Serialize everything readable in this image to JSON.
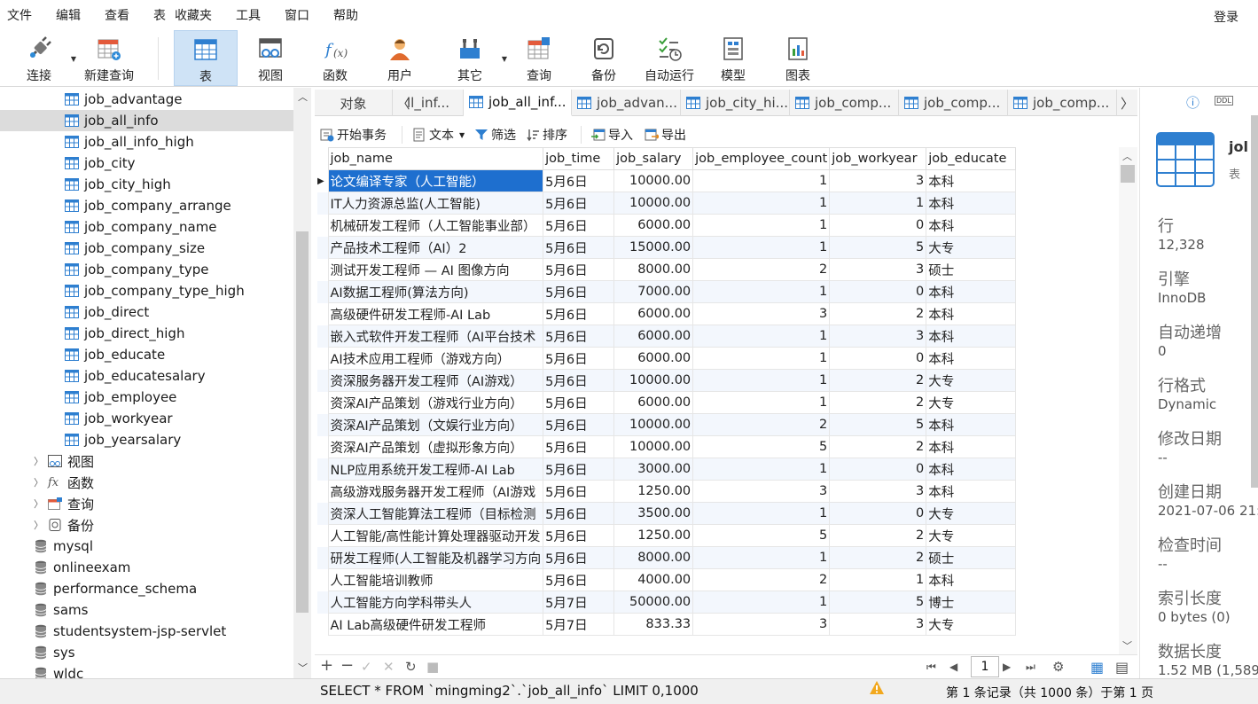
{
  "menu": {
    "items": [
      "文件",
      "编辑",
      "查看",
      "表",
      "收藏夹",
      "工具",
      "窗口",
      "帮助"
    ],
    "login": "登录"
  },
  "toolbar": {
    "buttons": [
      {
        "label": "连接",
        "icon": "plug-icon"
      },
      {
        "label": "新建查询",
        "icon": "new-query-icon"
      },
      {
        "label": "表",
        "icon": "table-icon"
      },
      {
        "label": "视图",
        "icon": "view-icon"
      },
      {
        "label": "函数",
        "icon": "function-icon"
      },
      {
        "label": "用户",
        "icon": "user-icon"
      },
      {
        "label": "其它",
        "icon": "tools-icon"
      },
      {
        "label": "查询",
        "icon": "query-icon"
      },
      {
        "label": "备份",
        "icon": "backup-icon"
      },
      {
        "label": "自动运行",
        "icon": "auto-run-icon"
      },
      {
        "label": "模型",
        "icon": "model-icon"
      },
      {
        "label": "图表",
        "icon": "chart-icon"
      }
    ]
  },
  "sidebar": {
    "tables": [
      "job_advantage",
      "job_all_info",
      "job_all_info_high",
      "job_city",
      "job_city_high",
      "job_company_arrange",
      "job_company_name",
      "job_company_size",
      "job_company_type",
      "job_company_type_high",
      "job_direct",
      "job_direct_high",
      "job_educate",
      "job_educatesalary",
      "job_employee",
      "job_workyear",
      "job_yearsalary"
    ],
    "folders": [
      "视图",
      "函数",
      "查询",
      "备份"
    ],
    "databases": [
      "mysql",
      "onlineexam",
      "performance_schema",
      "sams",
      "studentsystem-jsp-servlet",
      "sys",
      "wldc"
    ]
  },
  "tabs": {
    "object": "对象",
    "items": [
      "ll_inf...",
      "job_all_inf...",
      "job_advan...",
      "job_city_hi...",
      "job_comp...",
      "job_comp...",
      "job_comp..."
    ]
  },
  "actions": {
    "begin": "开始事务",
    "text": "文本",
    "filter": "筛选",
    "sort": "排序",
    "import": "导入",
    "export": "导出"
  },
  "grid": {
    "columns": [
      "job_name",
      "job_time",
      "job_salary",
      "job_employee_count",
      "job_workyear",
      "job_educate"
    ],
    "rows": [
      [
        "论文编译专家（人工智能）",
        "5月6日",
        "10000.00",
        "1",
        "3",
        "本科"
      ],
      [
        "IT人力资源总监(人工智能)",
        "5月6日",
        "10000.00",
        "1",
        "1",
        "本科"
      ],
      [
        "机械研发工程师（人工智能事业部）",
        "5月6日",
        "6000.00",
        "1",
        "0",
        "本科"
      ],
      [
        "产品技术工程师（AI）2",
        "5月6日",
        "15000.00",
        "1",
        "5",
        "大专"
      ],
      [
        "测试开发工程师 — AI 图像方向",
        "5月6日",
        "8000.00",
        "2",
        "3",
        "硕士"
      ],
      [
        "AI数据工程师(算法方向)",
        "5月6日",
        "7000.00",
        "1",
        "0",
        "本科"
      ],
      [
        "高级硬件研发工程师-AI Lab",
        "5月6日",
        "6000.00",
        "3",
        "2",
        "本科"
      ],
      [
        "嵌入式软件开发工程师（AI平台技术",
        "5月6日",
        "6000.00",
        "1",
        "3",
        "本科"
      ],
      [
        "AI技术应用工程师（游戏方向）",
        "5月6日",
        "6000.00",
        "1",
        "0",
        "本科"
      ],
      [
        "资深服务器开发工程师（AI游戏）",
        "5月6日",
        "10000.00",
        "1",
        "2",
        "大专"
      ],
      [
        "资深AI产品策划（游戏行业方向）",
        "5月6日",
        "6000.00",
        "1",
        "2",
        "大专"
      ],
      [
        "资深AI产品策划（文娱行业方向）",
        "5月6日",
        "10000.00",
        "2",
        "5",
        "本科"
      ],
      [
        "资深AI产品策划（虚拟形象方向）",
        "5月6日",
        "10000.00",
        "5",
        "2",
        "本科"
      ],
      [
        "NLP应用系统开发工程师-AI Lab",
        "5月6日",
        "3000.00",
        "1",
        "0",
        "本科"
      ],
      [
        "高级游戏服务器开发工程师（AI游戏",
        "5月6日",
        "1250.00",
        "3",
        "3",
        "本科"
      ],
      [
        "资深人工智能算法工程师（目标检测",
        "5月6日",
        "3500.00",
        "1",
        "0",
        "大专"
      ],
      [
        "人工智能/高性能计算处理器驱动开发",
        "5月6日",
        "1250.00",
        "5",
        "2",
        "大专"
      ],
      [
        "研发工程师(人工智能及机器学习方向",
        "5月6日",
        "8000.00",
        "1",
        "2",
        "硕士"
      ],
      [
        "人工智能培训教师",
        "5月6日",
        "4000.00",
        "2",
        "1",
        "本科"
      ],
      [
        "人工智能方向学科带头人",
        "5月7日",
        "50000.00",
        "1",
        "5",
        "博士"
      ],
      [
        "AI Lab高级硬件研发工程师",
        "5月7日",
        "833.33",
        "3",
        "3",
        "大专"
      ]
    ]
  },
  "nav": {
    "page": "1"
  },
  "info": {
    "name": "jol",
    "type": "表",
    "rows_label": "行",
    "rows": "12,328",
    "engine_label": "引擎",
    "engine": "InnoDB",
    "autoinc_label": "自动递增",
    "autoinc": "0",
    "rowfmt_label": "行格式",
    "rowfmt": "Dynamic",
    "modified_label": "修改日期",
    "modified": "--",
    "created_label": "创建日期",
    "created": "2021-07-06 21:",
    "checked_label": "检查时间",
    "checked": "--",
    "idxlen_label": "索引长度",
    "idxlen": "0 bytes (0)",
    "datalen_label": "数据长度",
    "datalen": "1.52 MB (1,589,"
  },
  "status": {
    "sql": "SELECT * FROM `mingming2`.`job_all_info` LIMIT 0,1000",
    "records": "第 1 条记录（共 1000 条）于第 1 页"
  }
}
